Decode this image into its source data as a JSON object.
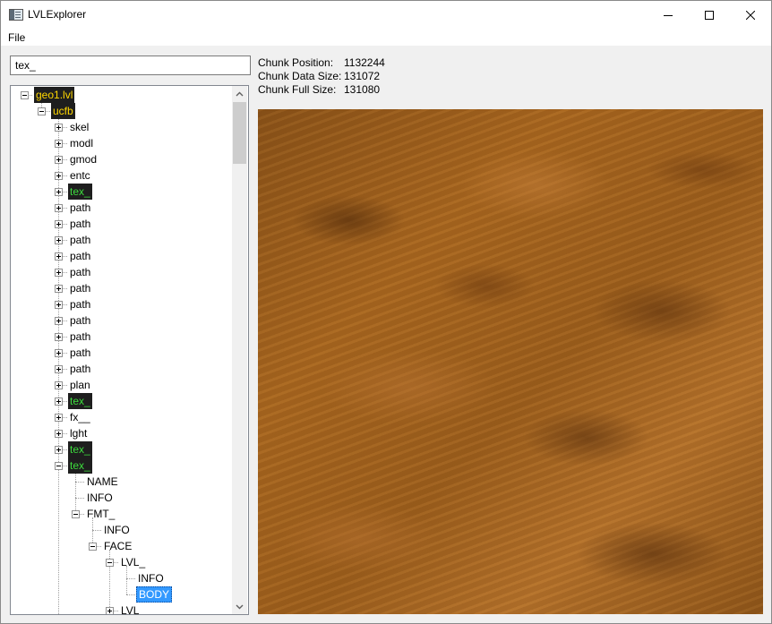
{
  "window": {
    "title": "LVLExplorer"
  },
  "menu": {
    "file": "File"
  },
  "search": {
    "value": "tex_"
  },
  "tree": {
    "nodes": [
      {
        "label": "geo1.lvl",
        "highlight": "yellow"
      },
      {
        "label": "ucfb",
        "highlight": "yellow"
      },
      {
        "label": "skel"
      },
      {
        "label": "modl"
      },
      {
        "label": "gmod"
      },
      {
        "label": "entc"
      },
      {
        "label": "tex_",
        "highlight": "green"
      },
      {
        "label": "path"
      },
      {
        "label": "path"
      },
      {
        "label": "path"
      },
      {
        "label": "path"
      },
      {
        "label": "path"
      },
      {
        "label": "path"
      },
      {
        "label": "path"
      },
      {
        "label": "path"
      },
      {
        "label": "path"
      },
      {
        "label": "path"
      },
      {
        "label": "path"
      },
      {
        "label": "plan"
      },
      {
        "label": "tex_",
        "highlight": "green"
      },
      {
        "label": "fx__"
      },
      {
        "label": "lght"
      },
      {
        "label": "tex_",
        "highlight": "green"
      },
      {
        "label": "tex_",
        "highlight": "green"
      },
      {
        "label": "NAME"
      },
      {
        "label": "INFO"
      },
      {
        "label": "FMT_"
      },
      {
        "label": "INFO"
      },
      {
        "label": "FACE"
      },
      {
        "label": "LVL_"
      },
      {
        "label": "INFO"
      },
      {
        "label": "BODY",
        "selected": true
      },
      {
        "label": "LVL_"
      }
    ]
  },
  "chunk": {
    "position_label": "Chunk Position:",
    "position_value": "1132244",
    "data_size_label": "Chunk Data Size:",
    "data_size_value": "131072",
    "full_size_label": "Chunk Full Size:",
    "full_size_value": "131080"
  },
  "colors": {
    "highlight_bg": "#1e1e1e",
    "highlight_yellow": "#ffd700",
    "highlight_green": "#3ddc3d",
    "selection": "#3399ff"
  }
}
